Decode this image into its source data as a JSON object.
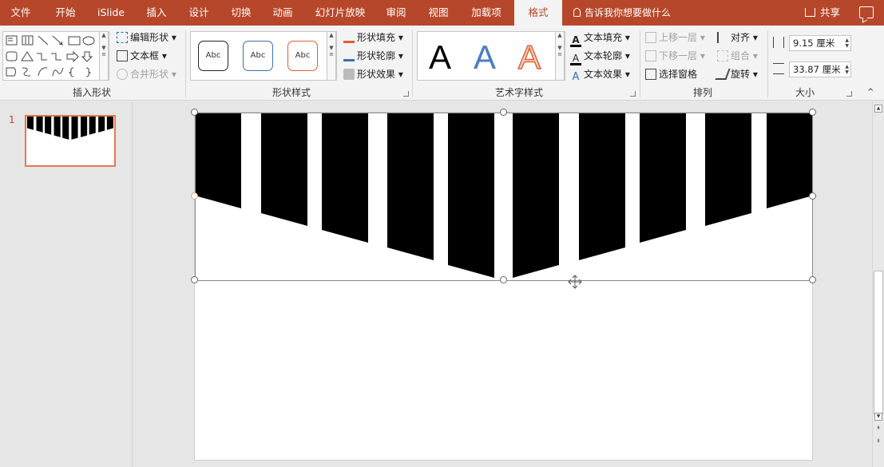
{
  "tabs": [
    {
      "label": "文件",
      "active": false
    },
    {
      "label": "开始",
      "active": false
    },
    {
      "label": "iSlide",
      "active": false
    },
    {
      "label": "插入",
      "active": false
    },
    {
      "label": "设计",
      "active": false
    },
    {
      "label": "切换",
      "active": false
    },
    {
      "label": "动画",
      "active": false
    },
    {
      "label": "幻灯片放映",
      "active": false
    },
    {
      "label": "审阅",
      "active": false
    },
    {
      "label": "视图",
      "active": false
    },
    {
      "label": "加载项",
      "active": false
    },
    {
      "label": "格式",
      "active": true
    }
  ],
  "tell_me": "告诉我你想要做什么",
  "share_label": "共享",
  "groups": {
    "insert_shapes": {
      "label": "插入形状",
      "edit_shape": "编辑形状",
      "text_box": "文本框",
      "merge_shapes": "合并形状"
    },
    "shape_styles": {
      "label": "形状样式",
      "preset_text": "Abc",
      "fill": "形状填充",
      "outline": "形状轮廓",
      "effects": "形状效果"
    },
    "wordart_styles": {
      "label": "艺术字样式",
      "preset_letter": "A",
      "text_fill": "文本填充",
      "text_outline": "文本轮廓",
      "text_effects": "文本效果"
    },
    "arrange": {
      "label": "排列",
      "bring_forward": "上移一层",
      "send_backward": "下移一层",
      "selection_pane": "选择窗格",
      "align": "对齐",
      "group": "组合",
      "rotate": "旋转"
    },
    "size": {
      "label": "大小",
      "height": "9.15 厘米",
      "width": "33.87 厘米"
    }
  },
  "slide_panel": {
    "slide_number": "1"
  },
  "colors": {
    "accent": "#b7472a",
    "thumb_border": "#e8784c",
    "shape_fill": "#000000"
  }
}
